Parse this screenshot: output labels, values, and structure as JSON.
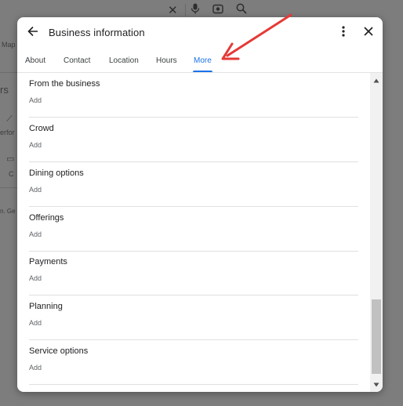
{
  "background": {
    "tab_fragment": "Map",
    "heading_fragment": "rs",
    "perf_fragment": "erfor",
    "c_fragment": "C",
    "bottom_fragment": "n. Ge"
  },
  "dialog": {
    "title": "Business information",
    "tabs": [
      {
        "label": "About"
      },
      {
        "label": "Contact"
      },
      {
        "label": "Location"
      },
      {
        "label": "Hours"
      },
      {
        "label": "More",
        "active": true
      }
    ],
    "sections": [
      {
        "title": "From the business",
        "action": "Add"
      },
      {
        "title": "Crowd",
        "action": "Add"
      },
      {
        "title": "Dining options",
        "action": "Add"
      },
      {
        "title": "Offerings",
        "action": "Add"
      },
      {
        "title": "Payments",
        "action": "Add"
      },
      {
        "title": "Planning",
        "action": "Add"
      },
      {
        "title": "Service options",
        "action": "Add"
      }
    ]
  },
  "icons": {
    "back": "arrow-left-icon",
    "more": "more-vert-icon",
    "close": "close-icon",
    "scroll_up": "caret-up-icon",
    "scroll_down": "caret-down-icon"
  },
  "colors": {
    "accent": "#1a73e8",
    "annotation_arrow": "#e53935",
    "overlay": "#7d7d7d"
  }
}
